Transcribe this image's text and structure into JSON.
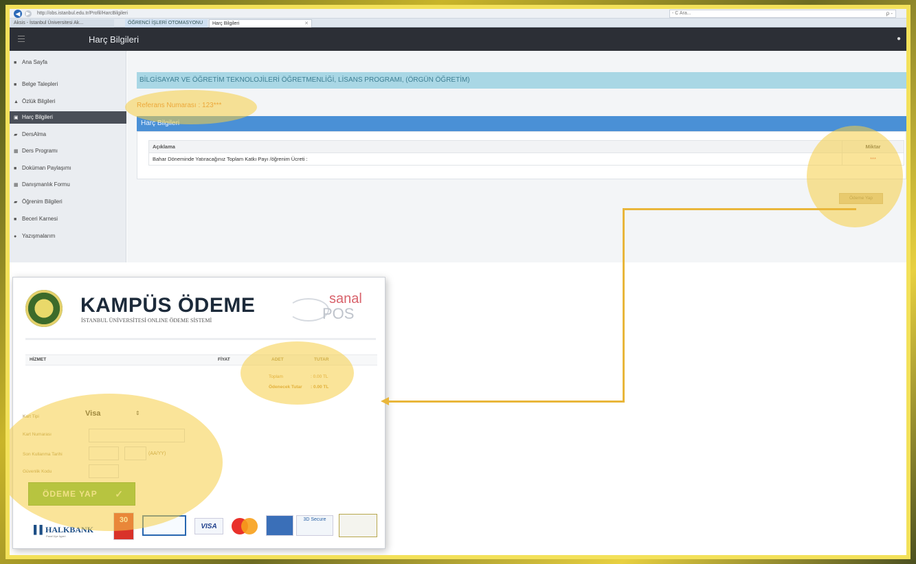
{
  "browser": {
    "url": "http://obs.istanbul.edu.tr/Profil/HarcBilgileri",
    "addr_right": "- C   Ara...",
    "search_caret": "ρ -",
    "tabs": [
      {
        "label": "Aksis - İstanbul Üniversitesi Ak..."
      },
      {
        "label": "ÖĞRENCİ İŞLERİ OTOMASYONU"
      },
      {
        "label": "Harç Bilgileri"
      }
    ]
  },
  "header": {
    "title": "Harç Bilgileri"
  },
  "sidebar": {
    "items": [
      {
        "icon": "■",
        "label": "Ana Sayfa"
      },
      {
        "icon": "■",
        "label": "Belge Talepleri"
      },
      {
        "icon": "▲",
        "label": "Özlük Bilgileri"
      },
      {
        "icon": "▣",
        "label": "Harç Bilgileri"
      },
      {
        "icon": "▰",
        "label": "DersAlma"
      },
      {
        "icon": "▦",
        "label": "Ders Programı"
      },
      {
        "icon": "■",
        "label": "Doküman Paylaşımı"
      },
      {
        "icon": "▦",
        "label": "Danışmanlık Formu"
      },
      {
        "icon": "▰",
        "label": "Öğrenim Bilgileri"
      },
      {
        "icon": "■",
        "label": "Beceri Karnesi"
      },
      {
        "icon": "●",
        "label": "Yazışmalarım"
      }
    ],
    "active_index": 3
  },
  "main": {
    "program": "BİLGİSAYAR VE ÖĞRETİM TEKNOLOJİLERİ ÖĞRETMENLİĞİ, LİSANS PROGRAMI, (ÖRGÜN ÖĞRETİM)",
    "reference": "Referans Numarası : 123***",
    "panel_title": "Harç Bilgileri",
    "table": {
      "headers": [
        "Açıklama",
        "Miktar"
      ],
      "rows": [
        {
          "desc": "Bahar Döneminde Yatıracağınız Toplam Katkı Payı /öğrenim Ücreti :",
          "amount": "***"
        }
      ]
    },
    "pay_button": "Ödeme Yap"
  },
  "pos": {
    "title": "KAMPÜS ÖDEME",
    "subtitle": "İSTANBUL ÜNİVERSİTESİ ONLINE ÖDEME SİSTEMİ",
    "logo_word1": "sanal",
    "logo_word2": "POS",
    "table_headers": {
      "service": "HİZMET",
      "price": "FİYAT",
      "qty": "ADET",
      "total": "TUTAR"
    },
    "totals": [
      {
        "label": "Toplam",
        "value": ": 0.00 TL"
      },
      {
        "label": "Ödenecek Tutar",
        "value": ": 0.00 TL"
      }
    ],
    "form": {
      "card_type_label": "Kart Tipi",
      "card_type_value": "Visa",
      "card_type_caret": "⇕",
      "card_number_label": "Kart Numarası",
      "expiry_label": "Son Kullanma Tarihi",
      "expiry_hint": "(AA/YY)",
      "cvv_label": "Güvenlik Kodu"
    },
    "pay_button": "ÖDEME YAP",
    "pay_check": "✓",
    "bank": "HALKBANK",
    "bank_sub": "Paraf Üye İşyeri",
    "badge_30": "30",
    "secure": "3D Secure",
    "visa": "VISA"
  },
  "colors": {
    "highlight": "#f6ce46",
    "arrow": "#e9b63a",
    "banner": "#a9d7e5",
    "panel_header": "#4a90d6",
    "pay_button": "#6ab93b"
  }
}
